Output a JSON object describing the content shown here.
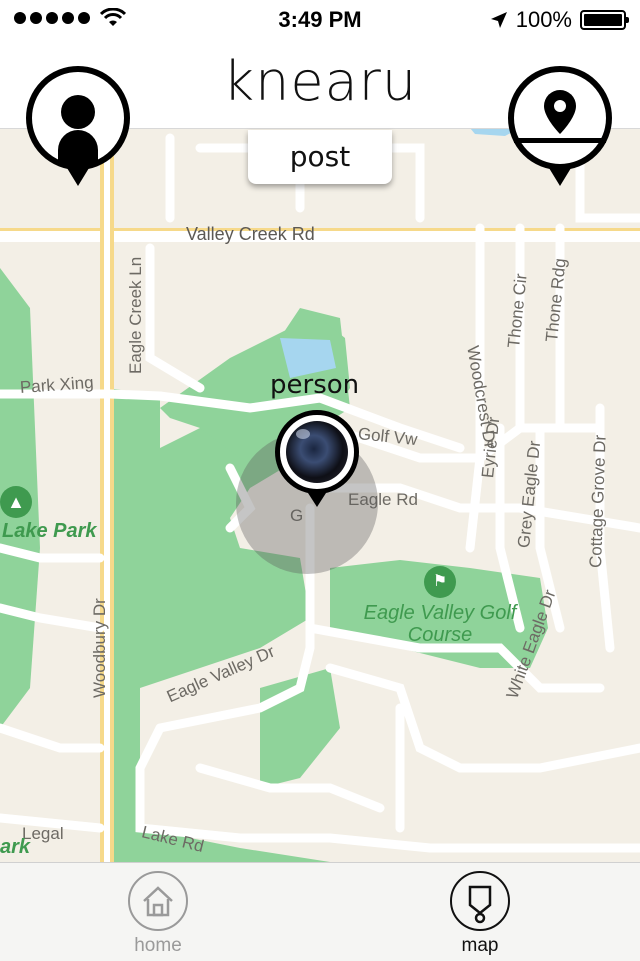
{
  "status_bar": {
    "time": "3:49 PM",
    "battery": "100%"
  },
  "header": {
    "title": "knearu",
    "post_label": "post"
  },
  "map": {
    "roads": [
      {
        "label": "Valley Creek Rd"
      },
      {
        "label": "Eagle Creek Ln"
      },
      {
        "label": "Woodcrest Dr"
      },
      {
        "label": "Thone Cir"
      },
      {
        "label": "Thone Rdg"
      },
      {
        "label": "Park Xing"
      },
      {
        "label": "Golf Vw"
      },
      {
        "label": "Eyrie Dr"
      },
      {
        "label": "Grey Eagle Dr"
      },
      {
        "label": "Cottage Grove Dr"
      },
      {
        "label": "Eagle Rd"
      },
      {
        "label": "G"
      },
      {
        "label": "Woodbury Dr"
      },
      {
        "label": "Eagle Valley Dr"
      },
      {
        "label": "White Eagle Dr"
      },
      {
        "label": "Legal"
      },
      {
        "label": "Lake Rd"
      }
    ],
    "parks": [
      {
        "label": "Lake Park"
      },
      {
        "label": "ark"
      }
    ],
    "golf_course": {
      "line1": "Eagle Valley Golf",
      "line2": "Course"
    }
  },
  "person_marker": {
    "label": "person"
  },
  "profile_button": {
    "icon": "person-icon"
  },
  "location_button": {
    "icon": "map-pin-icon"
  },
  "tabs": [
    {
      "label": "home",
      "icon": "home-icon",
      "active": false
    },
    {
      "label": "map",
      "icon": "map-icon",
      "active": true
    }
  ],
  "colors": {
    "map_background": "#f3efe6",
    "park_green": "#8fd39a",
    "water": "#a6d6ef",
    "road": "#ffffff",
    "major_road": "#f6d98a",
    "tab_active": "#111111",
    "tab_inactive": "#9a9a9a"
  }
}
